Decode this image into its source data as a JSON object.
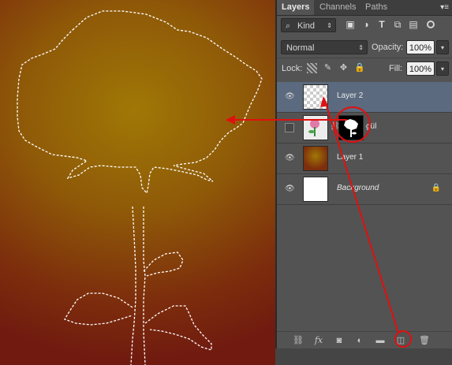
{
  "canvas": {
    "description": "flower-selection"
  },
  "tabs": {
    "layers": "Layers",
    "channels": "Channels",
    "paths": "Paths",
    "menu": "▾≡"
  },
  "filter": {
    "kind": "Kind"
  },
  "blend": {
    "mode": "Normal",
    "opacity_label": "Opacity:",
    "opacity_value": "100%"
  },
  "lock": {
    "label": "Lock:",
    "fill_label": "Fill:",
    "fill_value": "100%"
  },
  "layers": [
    {
      "name": "Layer 2",
      "selected": true
    },
    {
      "name": "gül",
      "selected": false
    },
    {
      "name": "Layer 1",
      "selected": false
    },
    {
      "name": "Background",
      "selected": false
    }
  ],
  "colors": {
    "panel": "#535353",
    "selected": "#5b6a7e",
    "annotation": "#e01010"
  }
}
